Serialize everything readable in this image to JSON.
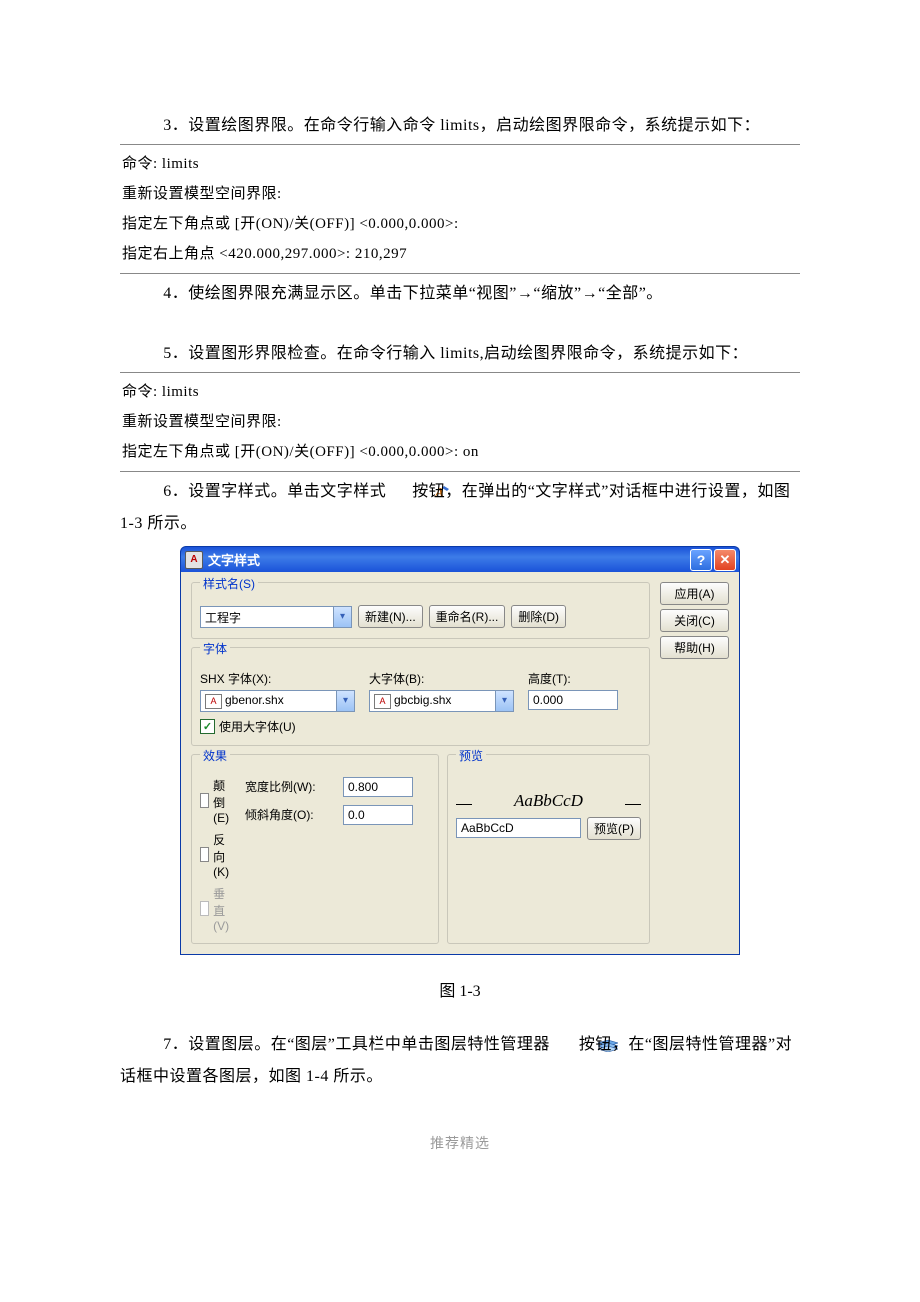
{
  "paragraphs": {
    "p3": "3．设置绘图界限。在命令行输入命令 limits，启动绘图界限命令，系统提示如下：",
    "p4": "4．使绘图界限充满显示区。单击下拉菜单“视图”→“缩放”→“全部”。",
    "p5": "5．设置图形界限检查。在命令行输入 limits,启动绘图界限命令，系统提示如下：",
    "p6_a": "6．设置字样式。单击文字样式",
    "p6_b": "按钮，在弹出的“文字样式”对话框中进行设置，如图 1-3 所示。",
    "p7_a": "7．设置图层。在“图层”工具栏中单击图层特性管理器",
    "p7_b": "按钮，在“图层特性管理器”对话框中设置各图层，如图 1-4 所示。"
  },
  "cmd1": {
    "l1": "命令: limits",
    "l2": "重新设置模型空间界限:",
    "l3": "指定左下角点或 [开(ON)/关(OFF)] <0.000,0.000>:",
    "l4": "指定右上角点 <420.000,297.000>: 210,297"
  },
  "cmd2": {
    "l1": "命令: limits",
    "l2": "重新设置模型空间界限:",
    "l3": "指定左下角点或 [开(ON)/关(OFF)] <0.000,0.000>: on"
  },
  "figcap": "图 1-3",
  "footer": "推荐精选",
  "dialog": {
    "title": "文字样式",
    "help_glyph": "?",
    "close_glyph": "✕",
    "right_buttons": {
      "apply": "应用(A)",
      "close": "关闭(C)",
      "help": "帮助(H)"
    },
    "style": {
      "legend": "样式名(S)",
      "combo_value": "工程字",
      "new_btn": "新建(N)...",
      "rename_btn": "重命名(R)...",
      "delete_btn": "删除(D)"
    },
    "font": {
      "legend": "字体",
      "shx_label": "SHX 字体(X):",
      "shx_value": "gbenor.shx",
      "big_label": "大字体(B):",
      "big_value": "gbcbig.shx",
      "height_label": "高度(T):",
      "height_value": "0.000",
      "use_big_label": "使用大字体(U)"
    },
    "effects": {
      "legend": "效果",
      "upside": "颠倒(E)",
      "reverse": "反向(K)",
      "vertical": "垂直(V)",
      "width_label": "宽度比例(W):",
      "width_value": "0.800",
      "oblique_label": "倾斜角度(O):",
      "oblique_value": "0.0"
    },
    "preview": {
      "legend": "预览",
      "sample": "AaBbCcD",
      "input_value": "AaBbCcD",
      "btn": "预览(P)"
    }
  }
}
